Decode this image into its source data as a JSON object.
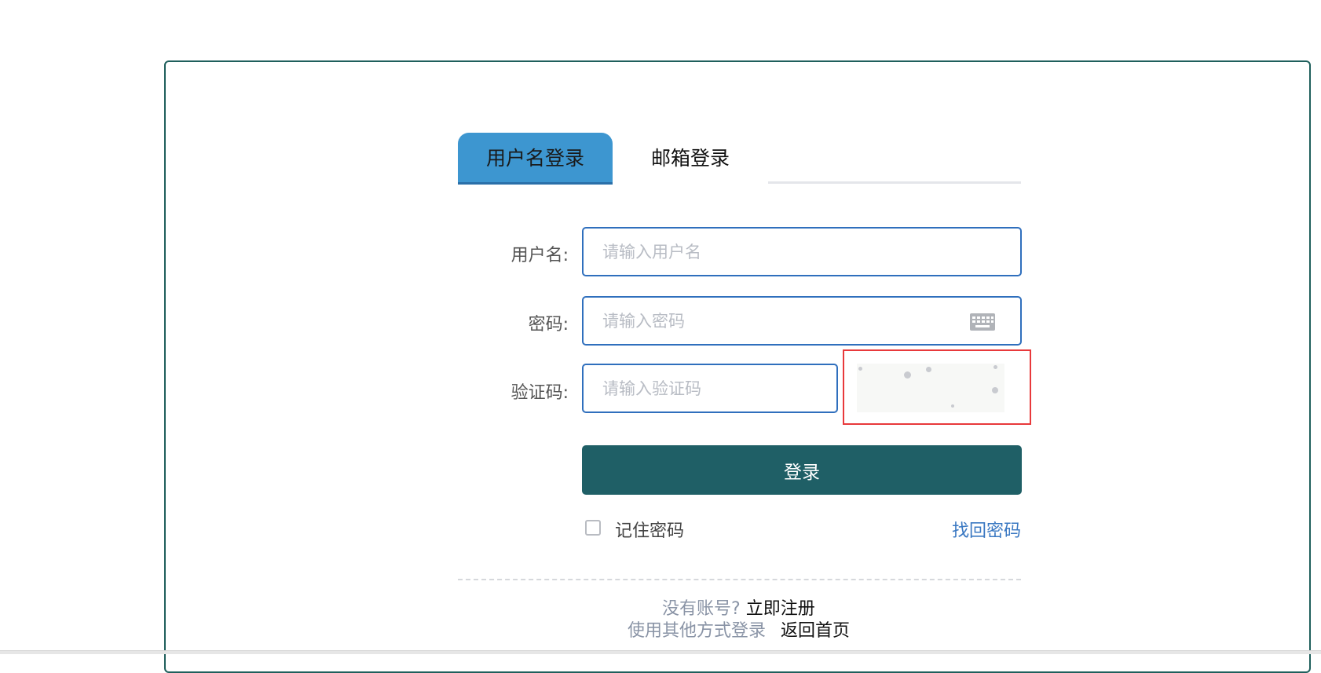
{
  "tabs": {
    "username_login": "用户名登录",
    "email_login": "邮箱登录"
  },
  "form": {
    "username_label": "用户名:",
    "username_placeholder": "请输入用户名",
    "password_label": "密码:",
    "password_placeholder": "请输入密码",
    "captcha_label": "验证码:",
    "captcha_placeholder": "请输入验证码",
    "login_button": "登录",
    "remember_password": "记住密码",
    "remember_checked": false,
    "forgot_password": "找回密码"
  },
  "footer": {
    "no_account": "没有账号?",
    "register_now": "立即注册",
    "other_login": "使用其他方式登录",
    "back_home": "返回首页"
  },
  "colors": {
    "panel_border": "#1f5f5c",
    "tab_active": "#3d96d0",
    "input_border": "#2f6fbd",
    "button": "#1f5f66",
    "captcha_highlight": "#e8393b",
    "link": "#3a78c2"
  }
}
